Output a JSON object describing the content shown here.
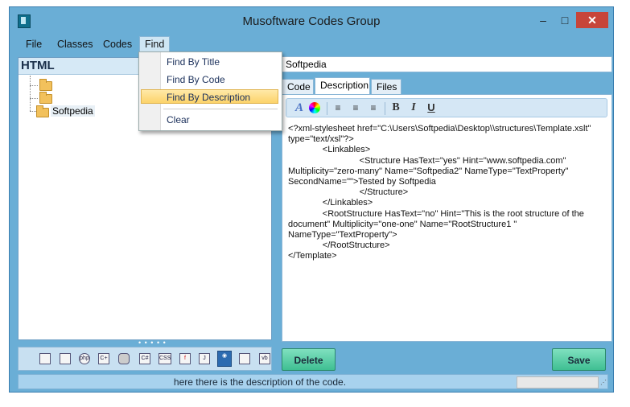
{
  "window": {
    "title": "Musoftware Codes Group",
    "minimize": "–",
    "maximize": "□",
    "close": "✕"
  },
  "menu": {
    "items": [
      "File",
      "Classes",
      "Codes",
      "Find"
    ]
  },
  "find_menu": {
    "items": [
      "Find By Title",
      "Find By Code",
      "Find By Description",
      "Clear"
    ],
    "highlighted": "Find By Description"
  },
  "tree": {
    "header": "HTML",
    "nodes": [
      "",
      "",
      "Softpedia"
    ]
  },
  "toolbar_icons": [
    "page-icon",
    "box-icon",
    "php-icon",
    "c-plus-plus-icon",
    "database-icon",
    "c-sharp-icon",
    "css-icon",
    "flash-icon",
    "java-icon",
    "html-globe-icon",
    "script-icon",
    "vb-icon"
  ],
  "search": {
    "value": "Softpedia"
  },
  "tabs": [
    "Code",
    "Description",
    "Files"
  ],
  "active_tab": "Description",
  "format_toolbar": {
    "bold": "B",
    "italic": "I",
    "underline": "U",
    "font": "A"
  },
  "description_lines": [
    "<?xml-stylesheet href=\"C:\\Users\\Softpedia\\Desktop\\\\structures\\Template.xslt\" type=\"text/xsl\"?>",
    "              <Linkables>",
    "                             <Structure HasText=\"yes\" Hint=\"www.softpedia.com\" Multiplicity=\"zero-many\" Name=\"Softpedia2\" NameType=\"TextProperty\" SecondName=\"\">Tested by Softpedia",
    "                             </Structure>",
    "              </Linkables>",
    "              <RootStructure HasText=\"no\" Hint=\"This is the root structure of the document\" Multiplicity=\"one-one\" Name=\"RootStructure1 \" NameType=\"TextProperty\">",
    "              </RootStructure>",
    "</Template>"
  ],
  "buttons": {
    "delete": "Delete",
    "save": "Save"
  },
  "status": {
    "text": "here there is the description of the code."
  },
  "colors": {
    "frame": "#6aaed6",
    "button": "#3fbf92",
    "highlight": "#fcd36a"
  }
}
